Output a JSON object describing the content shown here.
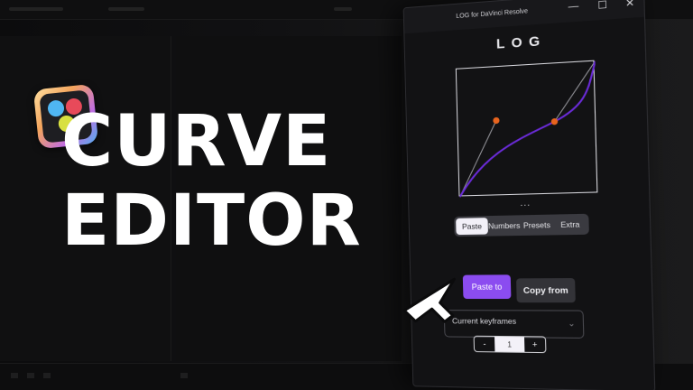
{
  "headline": {
    "line1": "CURVE",
    "line2": "EDITOR"
  },
  "window": {
    "title": "LOG for DaVinci Resolve",
    "controls": {
      "minimize": "—",
      "maximize": "☐",
      "close": "✕"
    },
    "app_title": "LOG",
    "more": "...",
    "tabs": [
      {
        "label": "Paste",
        "active": true
      },
      {
        "label": "Numbers",
        "active": false
      },
      {
        "label": "Presets",
        "active": false
      },
      {
        "label": "Extra",
        "active": false
      }
    ],
    "paste_button": "Paste to",
    "copy_button": "Copy from",
    "select": {
      "value": "Current keyframes"
    },
    "stepper": {
      "minus": "-",
      "value": "1",
      "plus": "+"
    }
  },
  "colors": {
    "accent": "#8b4cf0",
    "curve": "#6a2bd8",
    "handle": "#e8641e"
  },
  "icons": {
    "logo": "davinci-resolve-logo-icon",
    "cursor": "mouse-pointer-icon"
  }
}
